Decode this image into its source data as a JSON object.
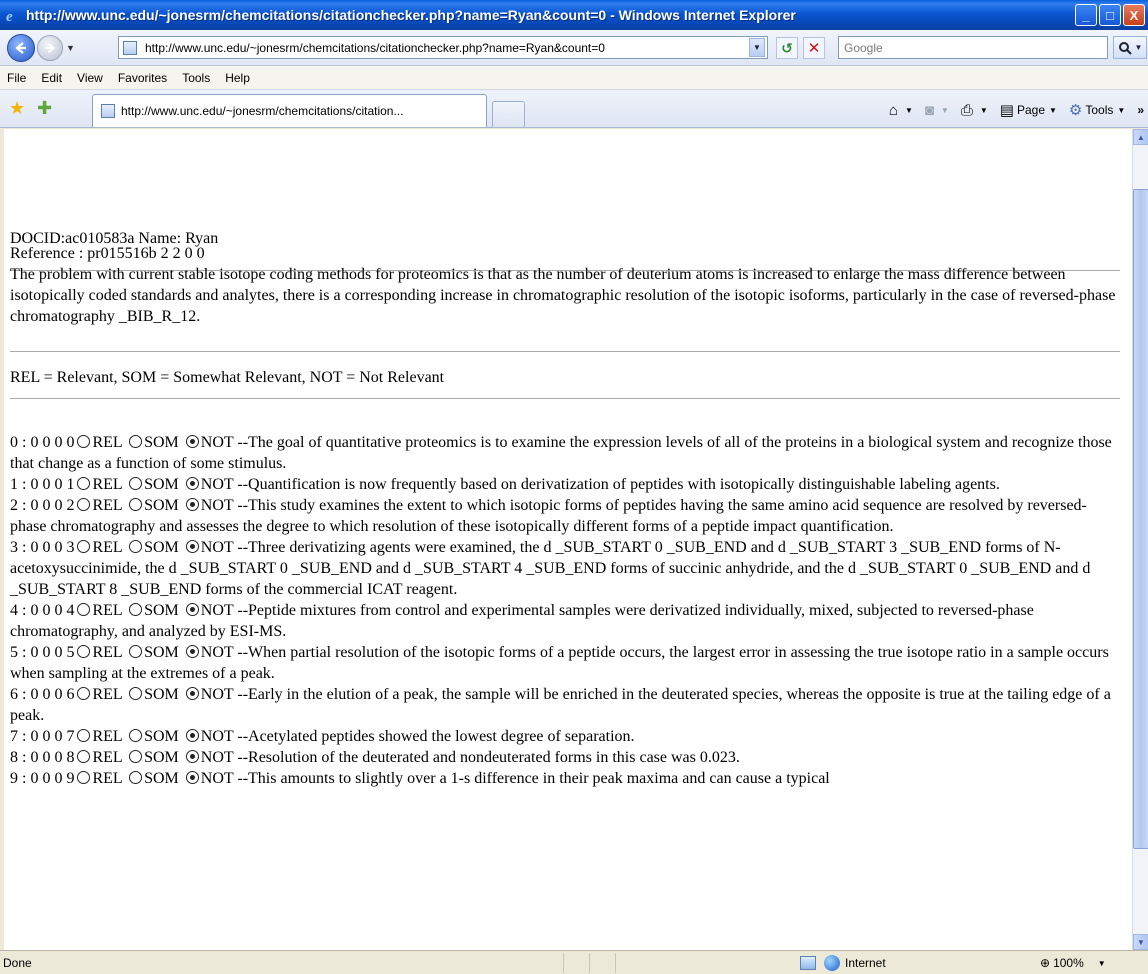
{
  "window": {
    "title": "http://www.unc.edu/~jonesrm/chemcitations/citationchecker.php?name=Ryan&count=0 - Windows Internet Explorer",
    "min_glyph": "_",
    "max_glyph": "□",
    "close_glyph": "X"
  },
  "nav": {
    "address": "http://www.unc.edu/~jonesrm/chemcitations/citationchecker.php?name=Ryan&count=0",
    "search_placeholder": "Google"
  },
  "menu": [
    "File",
    "Edit",
    "View",
    "Favorites",
    "Tools",
    "Help"
  ],
  "tab": {
    "label": "http://www.unc.edu/~jonesrm/chemcitations/citation..."
  },
  "commands": {
    "page_label": "Page",
    "tools_label": "Tools"
  },
  "doc": {
    "header": "DOCID:ac010583a Name: Ryan",
    "reference_line": "Reference : pr015516b 2 2 0 0",
    "reference_text": "The problem with current stable isotope coding methods for proteomics is that as the number of deuterium atoms is increased to enlarge the mass difference between isotopically coded standards and analytes, there is a corresponding increase in chromatographic resolution of the isotopic isoforms, particularly in the case of reversed-phase chromatography _BIB_R_12.",
    "legend": "REL = Relevant, SOM = Somewhat Relevant, NOT = Not Relevant",
    "options": [
      "REL",
      "SOM",
      "NOT"
    ],
    "sentences": [
      {
        "id": "0 : 0 0 0 0",
        "selected": "NOT",
        "text": "--The goal of quantitative proteomics is to examine the expression levels of all of the proteins in a biological system and recognize those that change as a function of some stimulus."
      },
      {
        "id": "1 : 0 0 0 1",
        "selected": "NOT",
        "text": "--Quantification is now frequently based on derivatization of peptides with isotopically distinguishable labeling agents."
      },
      {
        "id": "2 : 0 0 0 2",
        "selected": "NOT",
        "text": "--This study examines the extent to which isotopic forms of peptides having the same amino acid sequence are resolved by reversed-phase chromatography and assesses the degree to which resolution of these isotopically different forms of a peptide impact quantification."
      },
      {
        "id": "3 : 0 0 0 3",
        "selected": "NOT",
        "text": "--Three derivatizing agents were examined, the d _SUB_START 0 _SUB_END and d _SUB_START 3 _SUB_END forms of N-acetoxysuccinimide, the d _SUB_START 0 _SUB_END and d _SUB_START 4 _SUB_END forms of succinic anhydride, and the d _SUB_START 0 _SUB_END and d _SUB_START 8 _SUB_END forms of the commercial ICAT reagent."
      },
      {
        "id": "4 : 0 0 0 4",
        "selected": "NOT",
        "text": "--Peptide mixtures from control and experimental samples were derivatized individually, mixed, subjected to reversed-phase chromatography, and analyzed by ESI-MS."
      },
      {
        "id": "5 : 0 0 0 5",
        "selected": "NOT",
        "text": "--When partial resolution of the isotopic forms of a peptide occurs, the largest error in assessing the true isotope ratio in a sample occurs when sampling at the extremes of a peak."
      },
      {
        "id": "6 : 0 0 0 6",
        "selected": "NOT",
        "text": "--Early in the elution of a peak, the sample will be enriched in the deuterated species, whereas the opposite is true at the tailing edge of a peak."
      },
      {
        "id": "7 : 0 0 0 7",
        "selected": "NOT",
        "text": "--Acetylated peptides showed the lowest degree of separation."
      },
      {
        "id": "8 : 0 0 0 8",
        "selected": "NOT",
        "text": "--Resolution of the deuterated and nondeuterated forms in this case was 0.023."
      },
      {
        "id": "9 : 0 0 0 9",
        "selected": "NOT",
        "text": "--This amounts to slightly over a 1-s difference in their peak maxima and can cause a typical"
      }
    ]
  },
  "status": {
    "text": "Done",
    "zone": "Internet",
    "zoom": "100%"
  }
}
